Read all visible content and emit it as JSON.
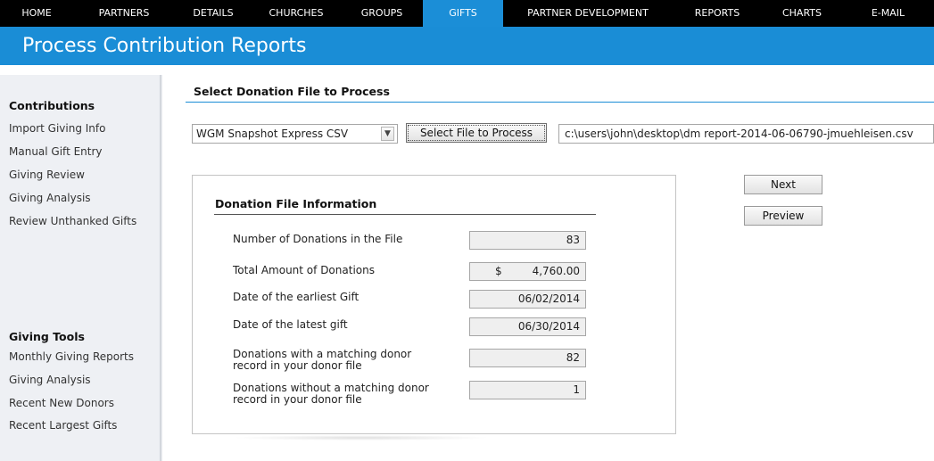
{
  "nav": {
    "items": [
      {
        "label": "HOME"
      },
      {
        "label": "PARTNERS"
      },
      {
        "label": "DETAILS"
      },
      {
        "label": "CHURCHES"
      },
      {
        "label": "GROUPS"
      },
      {
        "label": "GIFTS"
      },
      {
        "label": "PARTNER DEVELOPMENT"
      },
      {
        "label": "REPORTS"
      },
      {
        "label": "CHARTS"
      },
      {
        "label": "E-MAIL"
      }
    ],
    "active": "GIFTS",
    "active_color": "#1b8ed7"
  },
  "page": {
    "title": "Process Contribution Reports",
    "accent_color": "#1a8dd6"
  },
  "sidebar": {
    "contributions_heading": "Contributions",
    "contributions": [
      {
        "label": "Import Giving Info"
      },
      {
        "label": "Manual Gift Entry"
      },
      {
        "label": "Giving Review"
      },
      {
        "label": "Giving Analysis"
      },
      {
        "label": "Review Unthanked Gifts"
      }
    ],
    "tools_heading": "Giving Tools",
    "tools": [
      {
        "label": "Monthly Giving Reports"
      },
      {
        "label": "Giving Analysis"
      },
      {
        "label": "Recent New Donors"
      },
      {
        "label": "Recent Largest Gifts"
      }
    ]
  },
  "main": {
    "section_title": "Select Donation File to Process",
    "file_type_select": {
      "value": "WGM Snapshot Express CSV",
      "arrow_icon": "chevron-down-icon"
    },
    "select_file_button": "Select File to Process",
    "file_path": "c:\\users\\john\\desktop\\dm report-2014-06-06790-jmuehleisen.csv",
    "next_button": "Next",
    "preview_button": "Preview"
  },
  "info": {
    "title": "Donation File Information",
    "rows": [
      {
        "label": "Number of Donations in the File",
        "value": "83"
      },
      {
        "label": "Total Amount of Donations",
        "currency": "$",
        "value": "4,760.00"
      },
      {
        "label": "Date of the earliest Gift",
        "value": "06/02/2014"
      },
      {
        "label": "Date of the latest gift",
        "value": "06/30/2014"
      },
      {
        "label_line1": "Donations with a matching donor",
        "label_line2": "record in your donor file",
        "value": "82"
      },
      {
        "label_line1": "Donations without a matching donor",
        "label_line2": "record in your donor file",
        "value": "1"
      }
    ]
  }
}
